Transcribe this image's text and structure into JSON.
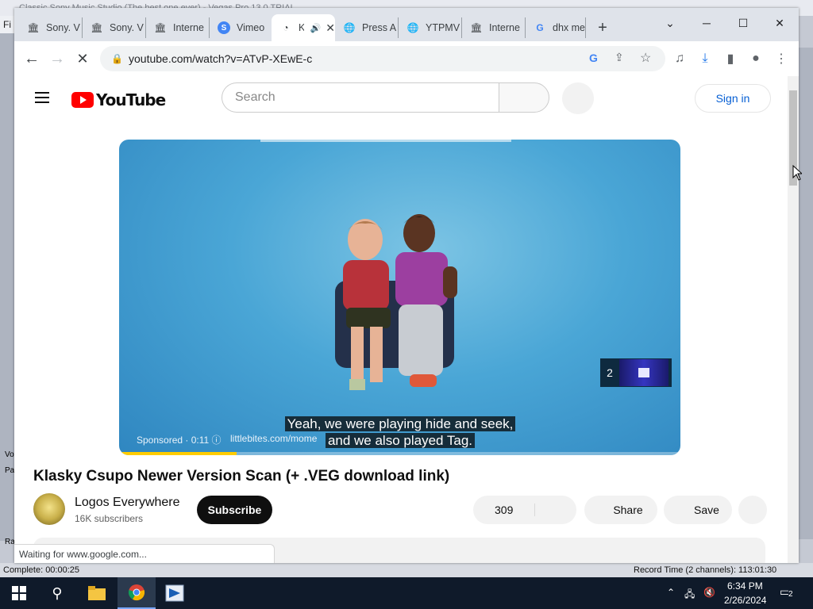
{
  "background_app": {
    "title": "Classic Sony Music Studio (The best one ever) - Vegas Pro 13.0 TRIAL",
    "menu_first": "Fi",
    "status_left": "Complete: 00:00:25",
    "status_right": "Record Time (2 channels): 113:01:30",
    "left_labels": [
      "Vo",
      "Pa",
      "Ra"
    ]
  },
  "browser": {
    "tabs": [
      {
        "label": "Sony. V",
        "icon": "museum-icon"
      },
      {
        "label": "Sony. V",
        "icon": "museum-icon"
      },
      {
        "label": "Interne",
        "icon": "museum-icon"
      },
      {
        "label": "Vimeo",
        "icon": "vimeo-icon"
      },
      {
        "label": "K",
        "icon": "loading-icon",
        "active": true
      },
      {
        "label": "Press A",
        "icon": "globe-icon"
      },
      {
        "label": "YTPMV",
        "icon": "globe-icon"
      },
      {
        "label": "Interne",
        "icon": "museum-icon"
      },
      {
        "label": "dhx me",
        "icon": "google-icon"
      }
    ],
    "new_tab_glyph": "+",
    "url": "youtube.com/watch?v=ATvP-XEwE-c",
    "status_text": "Waiting for www.google.com..."
  },
  "youtube": {
    "logo_text": "YouTube",
    "search_placeholder": "Search",
    "sign_in": "Sign in",
    "player": {
      "caption_line1": "Yeah, we were playing hide and seek,",
      "caption_line2": "and we also played Tag.",
      "sponsored": "Sponsored · 0:11 ⓘ",
      "sponsor_url": "littlebites.com/mome",
      "ad_count": "2",
      "progress_fraction": 0.21
    },
    "video_title": "Klasky Csupo Newer Version Scan (+ .VEG download link)",
    "channel_name": "Logos Everywhere",
    "subscribers": "16K subscribers",
    "subscribe": "Subscribe",
    "likes": "309",
    "share": "Share",
    "save": "Save"
  },
  "taskbar": {
    "time": "6:34 PM",
    "date": "2/26/2024",
    "notifications": "2"
  }
}
